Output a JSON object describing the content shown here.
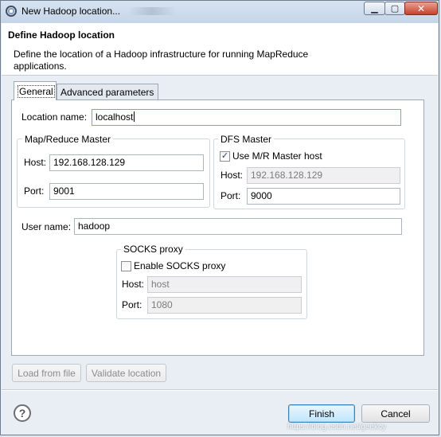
{
  "window": {
    "title": "New Hadoop location...",
    "minimize_glyph": "▁",
    "maximize_glyph": "▢",
    "close_glyph": "✕"
  },
  "banner": {
    "title": "Define Hadoop location",
    "description": "Define the location of a Hadoop infrastructure for running MapReduce applications."
  },
  "tabs": [
    {
      "label": "General",
      "selected": true
    },
    {
      "label": "Advanced parameters",
      "selected": false
    }
  ],
  "form": {
    "location_name_label": "Location name:",
    "location_name_value": "localhost",
    "mr_master": {
      "legend": "Map/Reduce Master",
      "host_label": "Host:",
      "host_value": "192.168.128.129",
      "port_label": "Port:",
      "port_value": "9001"
    },
    "dfs_master": {
      "legend": "DFS Master",
      "use_mr_host_label": "Use M/R Master host",
      "use_mr_host_checked": true,
      "host_label": "Host:",
      "host_value": "192.168.128.129",
      "port_label": "Port:",
      "port_value": "9000"
    },
    "user_name_label": "User name:",
    "user_name_value": "hadoop",
    "socks": {
      "legend": "SOCKS proxy",
      "enable_label": "Enable SOCKS proxy",
      "enable_checked": false,
      "host_label": "Host:",
      "host_value": "host",
      "port_label": "Port:",
      "port_value": "1080"
    }
  },
  "buttons": {
    "load_from_file": "Load from file",
    "validate_location": "Validate location",
    "finish": "Finish",
    "cancel": "Cancel"
  },
  "help_glyph": "?",
  "check_glyph": "✓",
  "watermark": "https://blog.csdn.net/geekcy",
  "colors": {
    "primary_button": "#bee6fd",
    "close_button": "#c7412c"
  }
}
